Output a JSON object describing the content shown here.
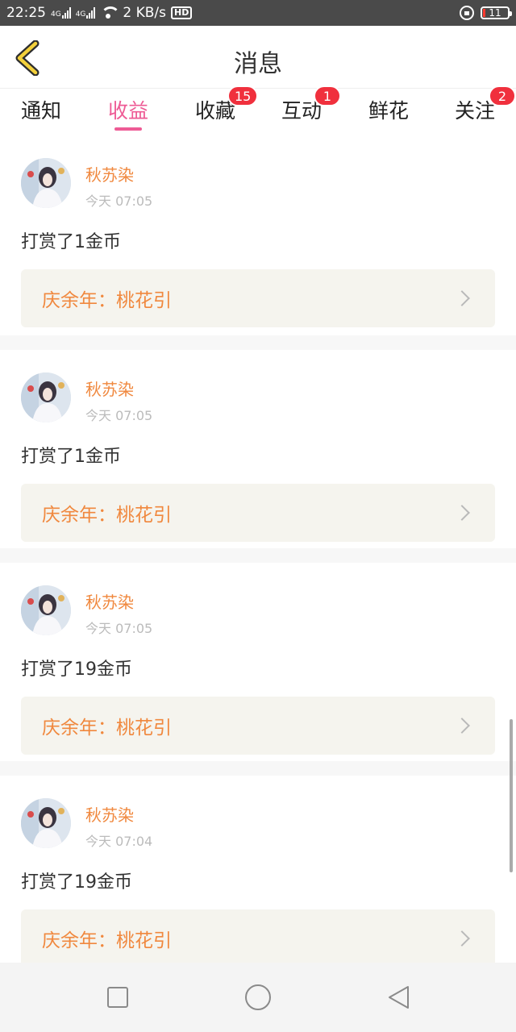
{
  "status_bar": {
    "time": "22:25",
    "network": "4G",
    "speed": "2 KB/s",
    "hd": "HD",
    "battery": "11",
    "icons": [
      "signal-icon",
      "wifi-icon",
      "hd-icon",
      "rotation-lock-icon",
      "battery-icon"
    ]
  },
  "header": {
    "title": "消息",
    "back_icon": "chevron-left-icon",
    "accent": "#f3d03b"
  },
  "tabs": [
    {
      "label": "通知",
      "badge": "",
      "active": false
    },
    {
      "label": "收益",
      "badge": "",
      "active": true
    },
    {
      "label": "收藏",
      "badge": "15",
      "active": false
    },
    {
      "label": "互动",
      "badge": "1",
      "active": false
    },
    {
      "label": "鲜花",
      "badge": "",
      "active": false
    },
    {
      "label": "关注",
      "badge": "2",
      "active": false
    }
  ],
  "colors": {
    "active_tab": "#ee5b95",
    "username": "#f0883e",
    "badge": "#f0303d",
    "link_bg": "#f5f4ee"
  },
  "items": [
    {
      "user": "秋苏染",
      "time": "今天 07:05",
      "message": "打赏了1金币",
      "book": "庆余年：桃花引"
    },
    {
      "user": "秋苏染",
      "time": "今天 07:05",
      "message": "打赏了1金币",
      "book": "庆余年：桃花引"
    },
    {
      "user": "秋苏染",
      "time": "今天 07:05",
      "message": "打赏了19金币",
      "book": "庆余年：桃花引"
    },
    {
      "user": "秋苏染",
      "time": "今天 07:04",
      "message": "打赏了19金币",
      "book": "庆余年：桃花引"
    }
  ],
  "nav_bar": {
    "icons": [
      "recent-apps-icon",
      "home-icon",
      "back-icon"
    ]
  }
}
